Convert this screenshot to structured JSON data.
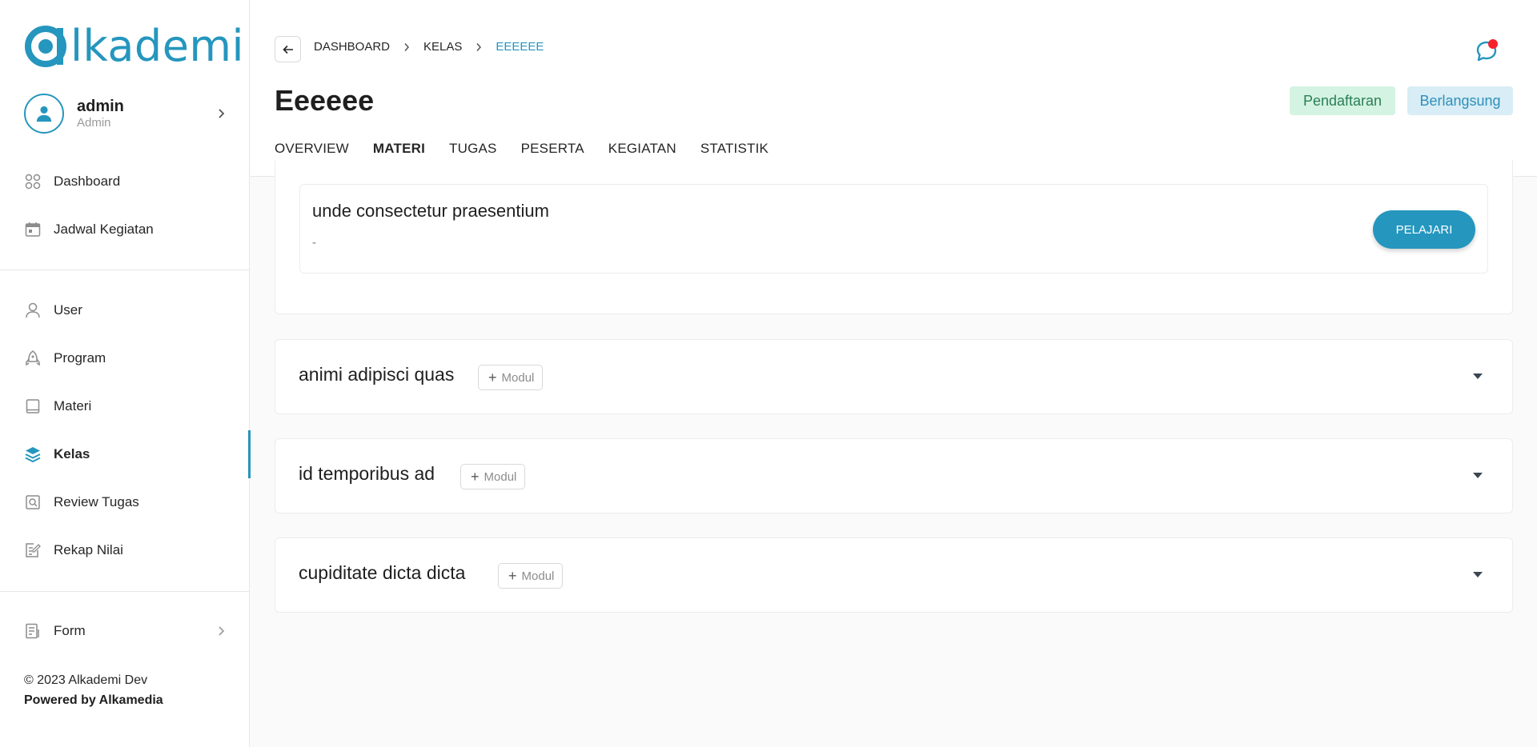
{
  "brand": {
    "logo_text": "lkademi",
    "accent": "#2596be"
  },
  "user": {
    "name": "admin",
    "role": "Admin"
  },
  "sidebar": {
    "items": [
      {
        "label": "Dashboard",
        "icon": "grid-icon"
      },
      {
        "label": "Jadwal Kegiatan",
        "icon": "calendar-icon"
      },
      {
        "label": "User",
        "icon": "user-icon"
      },
      {
        "label": "Program",
        "icon": "rocket-icon"
      },
      {
        "label": "Materi",
        "icon": "book-icon"
      },
      {
        "label": "Kelas",
        "icon": "layers-icon",
        "active": true
      },
      {
        "label": "Review Tugas",
        "icon": "review-icon"
      },
      {
        "label": "Rekap Nilai",
        "icon": "edit-list-icon"
      },
      {
        "label": "Form",
        "icon": "form-icon"
      }
    ],
    "footer_copy": "© 2023 Alkademi Dev",
    "footer_powered": "Powered by Alkamedia"
  },
  "breadcrumb": [
    "DASHBOARD",
    "KELAS",
    "EEEEEE"
  ],
  "header": {
    "title": "Eeeeee",
    "tags": [
      "Pendaftaran",
      "Berlangsung"
    ],
    "tabs": [
      "OVERVIEW",
      "MATERI",
      "TUGAS",
      "PESERTA",
      "KEGIATAN",
      "STATISTIK"
    ],
    "active_tab": "MATERI"
  },
  "materi": {
    "expanded_item": {
      "title": "unde consectetur praesentium",
      "desc": "-",
      "button": "PELAJARI"
    },
    "sections": [
      {
        "title": "animi adipisci quas",
        "modul_label": "Modul"
      },
      {
        "title": "id temporibus ad",
        "modul_label": "Modul"
      },
      {
        "title": "cupiditate dicta dicta",
        "modul_label": "Modul"
      }
    ]
  }
}
